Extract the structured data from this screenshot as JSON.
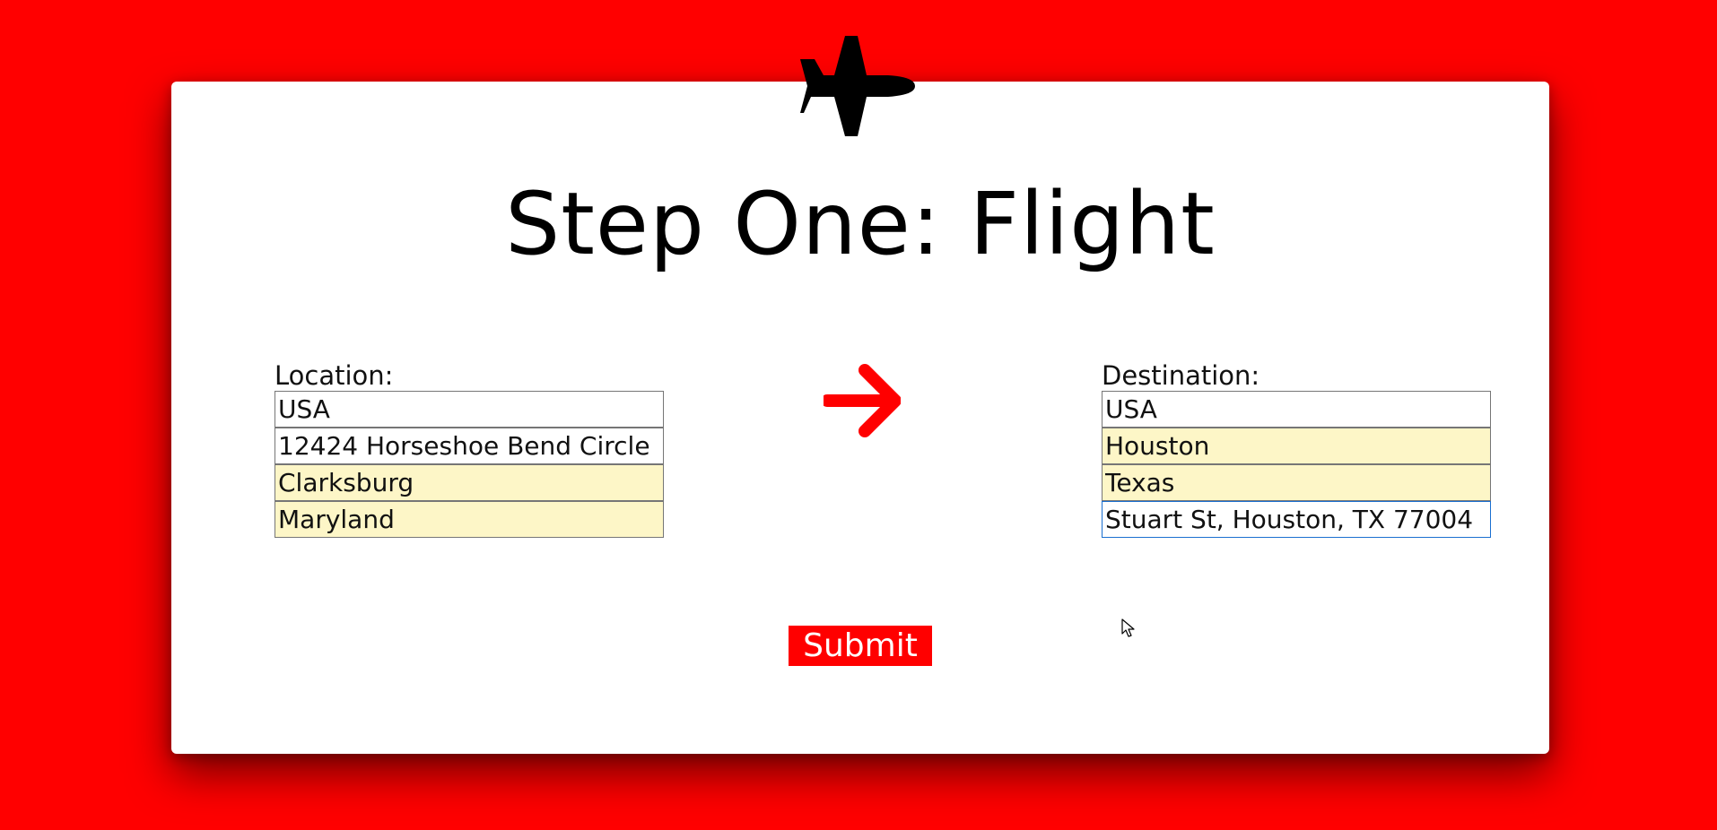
{
  "page": {
    "title": "Step One: Flight",
    "background_color": "#ff0000",
    "card_color": "#ffffff",
    "header_icon": "airplane-icon",
    "direction_icon": "arrow-right-icon"
  },
  "location": {
    "label": "Location:",
    "fields": [
      {
        "value": "USA",
        "autofilled": false
      },
      {
        "value": "12424 Horseshoe Bend Circle",
        "autofilled": false
      },
      {
        "value": "Clarksburg",
        "autofilled": true
      },
      {
        "value": "Maryland",
        "autofilled": true
      }
    ]
  },
  "destination": {
    "label": "Destination:",
    "fields": [
      {
        "value": "USA",
        "autofilled": false
      },
      {
        "value": "Houston",
        "autofilled": true
      },
      {
        "value": "Texas",
        "autofilled": true
      },
      {
        "value": "Stuart St, Houston, TX 77004",
        "autofilled": false,
        "focused": true
      }
    ]
  },
  "submit": {
    "label": "Submit",
    "color": "#ff0000"
  },
  "colors": {
    "autofill": "#fdf6c7",
    "focus_border": "#1a6fd0",
    "arrow": "#ff0000"
  }
}
